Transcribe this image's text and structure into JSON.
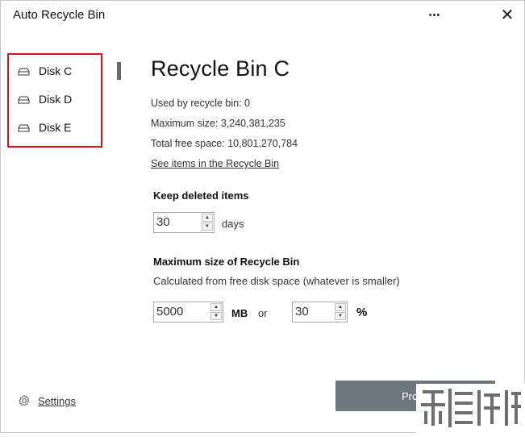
{
  "app": {
    "title": "Auto Recycle Bin"
  },
  "window_controls": {
    "more": "•••",
    "close": "✕"
  },
  "sidebar": {
    "disks": [
      {
        "label": "Disk C",
        "icon": "drive-icon"
      },
      {
        "label": "Disk D",
        "icon": "drive-icon"
      },
      {
        "label": "Disk E",
        "icon": "drive-icon"
      }
    ],
    "settings_label": "Settings",
    "highlight_color": "#e01010"
  },
  "main": {
    "heading": "Recycle Bin C",
    "used": "Used by recycle bin: 0",
    "max_size": "Maximum size: 3,240,381,235",
    "free_space": "Total free space: 10,801,270,784",
    "see_items_link": "See items in the Recycle Bin",
    "keep": {
      "title": "Keep deleted items",
      "value": "30",
      "unit": "days"
    },
    "maxsize": {
      "title": "Maximum size of Recycle Bin",
      "subtitle": "Calculated from free disk space (whatever is smaller)",
      "mb_value": "5000",
      "mb_unit": "MB",
      "or": "or",
      "pct_value": "30",
      "pct_unit": "%"
    }
  },
  "footer": {
    "proceed_label": "Proce",
    "proceed_color": "#6e777d"
  }
}
